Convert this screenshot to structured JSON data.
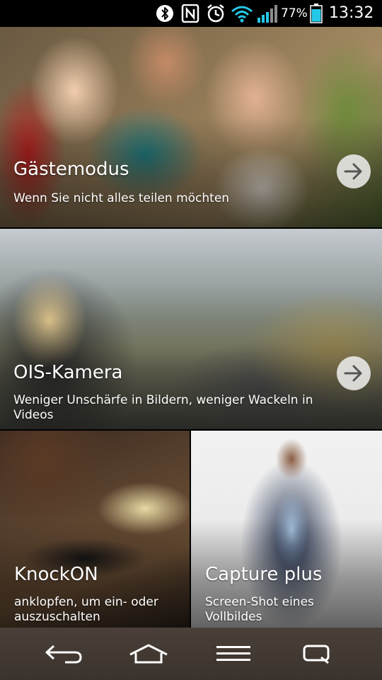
{
  "status_bar": {
    "battery_percent": "77%",
    "time": "13:32",
    "icons": [
      "bluetooth-icon",
      "nfc-icon",
      "alarm-icon",
      "wifi-icon",
      "signal-icon",
      "battery-icon"
    ]
  },
  "cards": [
    {
      "title": "Gästemodus",
      "subtitle": "Wenn Sie nicht alles teilen möchten",
      "action_icon": "arrow-right-icon"
    },
    {
      "title": "OIS-Kamera",
      "subtitle": "Weniger Unschärfe in Bildern, weniger Wackeln in Videos",
      "action_icon": "arrow-right-icon"
    },
    {
      "title": "KnockON",
      "subtitle": "anklopfen, um ein- oder auszuschalten"
    },
    {
      "title": "Capture plus",
      "subtitle": "Screen-Shot eines Vollbildes"
    }
  ],
  "navigation": {
    "buttons": [
      "back-icon",
      "home-icon",
      "menu-icon",
      "qslide-icon"
    ]
  },
  "colors": {
    "battery": "#25c9e8",
    "navbar": "#3f362f",
    "accent_icons": "#ffffff"
  }
}
